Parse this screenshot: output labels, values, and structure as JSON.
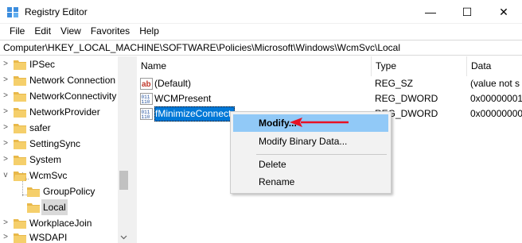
{
  "window": {
    "title": "Registry Editor",
    "minimize_glyph": "—",
    "maximize_glyph": "☐",
    "close_glyph": "✕"
  },
  "menu": [
    "File",
    "Edit",
    "View",
    "Favorites",
    "Help"
  ],
  "address": "Computer\\HKEY_LOCAL_MACHINE\\SOFTWARE\\Policies\\Microsoft\\Windows\\WcmSvc\\Local",
  "tree": {
    "items": [
      {
        "label": "IPSec",
        "expander": ">",
        "selected": false
      },
      {
        "label": "Network Connection",
        "expander": ">",
        "selected": false
      },
      {
        "label": "NetworkConnectivity",
        "expander": ">",
        "selected": false
      },
      {
        "label": "NetworkProvider",
        "expander": ">",
        "selected": false
      },
      {
        "label": "safer",
        "expander": ">",
        "selected": false
      },
      {
        "label": "SettingSync",
        "expander": ">",
        "selected": false
      },
      {
        "label": "System",
        "expander": ">",
        "selected": false
      },
      {
        "label": "WcmSvc",
        "expander": "v",
        "selected": false
      },
      {
        "label": "GroupPolicy",
        "expander": "",
        "selected": false
      },
      {
        "label": "Local",
        "expander": "",
        "selected": true
      },
      {
        "label": "WorkplaceJoin",
        "expander": ">",
        "selected": false
      },
      {
        "label": "WSDAPI",
        "expander": ">",
        "selected": false
      }
    ]
  },
  "columns": {
    "name": "Name",
    "type": "Type",
    "data": "Data"
  },
  "values": [
    {
      "name": "(Default)",
      "type": "REG_SZ",
      "data": "(value not s",
      "icon": "string-value-icon"
    },
    {
      "name": "WCMPresent",
      "type": "REG_DWORD",
      "data": "0x00000001",
      "icon": "dword-value-icon"
    },
    {
      "name": "fMinimizeConnect",
      "type": "REG_DWORD",
      "data": "0x00000000",
      "icon": "dword-value-icon",
      "selected": true
    }
  ],
  "context_menu": {
    "items": [
      "Modify...",
      "Modify Binary Data...",
      "Delete",
      "Rename"
    ]
  },
  "colors": {
    "selection": "#0078d7",
    "menu_highlight": "#91c9f7",
    "annotation_arrow": "#e81123",
    "folder": "#e8b84a"
  }
}
